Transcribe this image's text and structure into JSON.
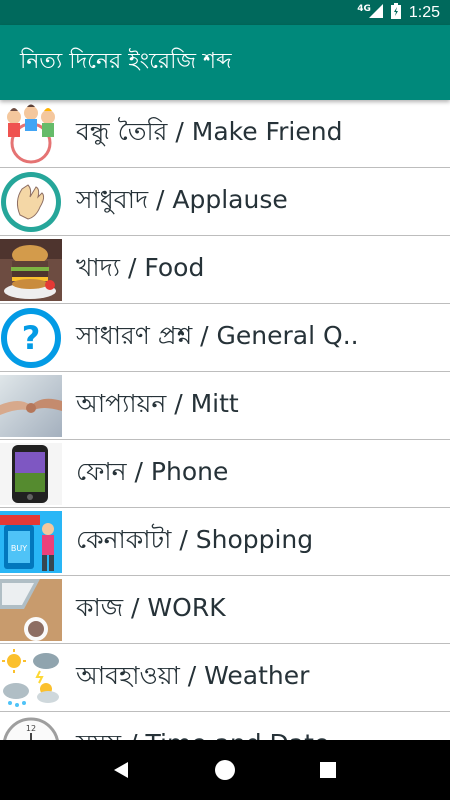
{
  "status": {
    "network": "4G",
    "time": "1:25"
  },
  "app_bar": {
    "title": "নিত্য দিনের ইংরেজি শব্দ"
  },
  "items": [
    {
      "label": "বন্ধু তৈরি / Make Friend",
      "icon": "friends-icon"
    },
    {
      "label": "সাধুবাদ / Applause",
      "icon": "clapping-hands-icon"
    },
    {
      "label": "খাদ্য / Food",
      "icon": "burger-icon"
    },
    {
      "label": "সাধারণ প্রশ্ন / General Q..",
      "icon": "question-mark-icon"
    },
    {
      "label": "আপ্যায়ন / Mitt",
      "icon": "holding-hands-icon"
    },
    {
      "label": "ফোন / Phone",
      "icon": "phone-icon"
    },
    {
      "label": "কেনাকাটা / Shopping",
      "icon": "shopping-icon"
    },
    {
      "label": "কাজ / WORK",
      "icon": "laptop-icon"
    },
    {
      "label": "আবহাওয়া / Weather",
      "icon": "weather-icon"
    },
    {
      "label": "সময় / Time and Date",
      "icon": "clock-icon"
    }
  ],
  "colors": {
    "status_bar": "#00695c",
    "app_bar": "#00897b",
    "label_text": "#263238"
  }
}
